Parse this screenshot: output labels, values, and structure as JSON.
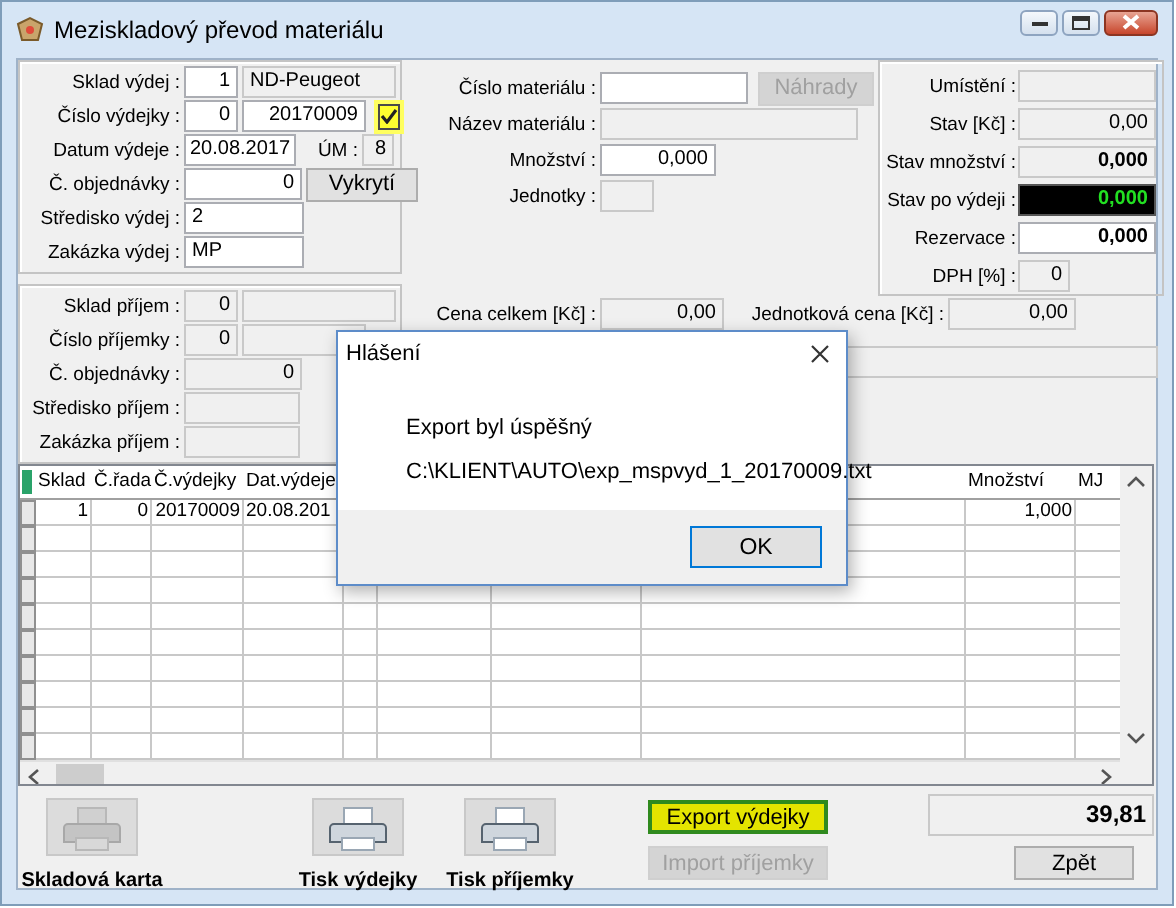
{
  "window": {
    "title": "Meziskladový převod materiálu"
  },
  "issue": {
    "warehouse": {
      "label": "Sklad výdej :",
      "code": {
        "value": "1",
        "readonly": false
      },
      "name": {
        "value": "ND-Peugeot",
        "readonly": true
      }
    },
    "slip": {
      "label": "Číslo výdejky :",
      "series": {
        "value": "0",
        "readonly": false
      },
      "number": {
        "value": "20170009",
        "readonly": false
      },
      "confirm": {
        "checked": true,
        "highlighted": true
      }
    },
    "date": {
      "label": "Datum výdeje :",
      "field": {
        "value": "20.08.2017",
        "readonly": false
      },
      "um_label": "ÚM :",
      "um": {
        "value": "8",
        "readonly": true
      }
    },
    "order": {
      "label": "Č. objednávky :",
      "field": {
        "value": "0",
        "readonly": false
      },
      "button": {
        "label": "Vykrytí",
        "disabled": false
      }
    },
    "center": {
      "label": "Středisko výdej :",
      "field": {
        "value": "2",
        "readonly": false
      }
    },
    "job": {
      "label": "Zakázka výdej :",
      "field": {
        "value": "MP",
        "readonly": false
      }
    }
  },
  "receipt": {
    "warehouse": {
      "label": "Sklad příjem :",
      "code": {
        "value": "0",
        "readonly": true
      },
      "name": {
        "readonly": true
      }
    },
    "slip": {
      "label": "Číslo příjemky :",
      "series": {
        "value": "0",
        "readonly": true
      },
      "number": {
        "readonly": true
      }
    },
    "order": {
      "label": "Č. objednávky :",
      "field": {
        "value": "0",
        "readonly": true
      }
    },
    "center": {
      "label": "Středisko příjem :",
      "field": {
        "readonly": true
      }
    },
    "job": {
      "label": "Zakázka příjem :",
      "field": {
        "readonly": true
      }
    }
  },
  "material": {
    "number": {
      "label": "Číslo materiálu :",
      "field": {
        "readonly": false
      },
      "button": {
        "label": "Náhrady",
        "disabled": true
      }
    },
    "name": {
      "label": "Název materiálu :",
      "field": {
        "readonly": true
      }
    },
    "quantity": {
      "label": "Množství :",
      "field": {
        "value": "0,000",
        "readonly": false
      }
    },
    "unit": {
      "label": "Jednotky :",
      "field": {
        "readonly": true
      }
    }
  },
  "stock": {
    "location": {
      "label": "Umístění :",
      "field": {
        "readonly": true
      }
    },
    "value": {
      "label": "Stav [Kč] :",
      "field": {
        "value": "0,00",
        "readonly": true
      }
    },
    "quantity": {
      "label": "Stav množství :",
      "field": {
        "value": "0,000",
        "readonly": true
      }
    },
    "after_issue": {
      "label": "Stav po výdeji :",
      "field": {
        "value": "0,000"
      }
    },
    "reservation": {
      "label": "Rezervace :",
      "field": {
        "value": "0,000",
        "readonly": false
      }
    },
    "vat": {
      "label": "DPH [%] :",
      "field": {
        "value": "0",
        "readonly": true
      }
    }
  },
  "prices": {
    "total": {
      "label": "Cena celkem [Kč] :",
      "field": {
        "value": "0,00",
        "readonly": true
      }
    },
    "unit": {
      "label": "Jednotková cena [Kč] :",
      "field": {
        "value": "0,00",
        "readonly": true
      }
    },
    "note": {
      "readonly": true
    }
  },
  "table": {
    "columns": [
      "Sklad",
      "Č.řada",
      "Č.výdejky",
      "Dat.výdeje",
      "Množství",
      "MJ"
    ],
    "rows": [
      {
        "cells": [
          "1",
          "0",
          "20170009",
          "20.08.201",
          "1,000"
        ]
      }
    ]
  },
  "footer": {
    "card": {
      "label": "Skladová karta",
      "disabled": true
    },
    "print_issue": {
      "label": "Tisk výdejky",
      "disabled": false
    },
    "print_receipt": {
      "label": "Tisk příjemky",
      "disabled": false
    },
    "export": {
      "label": "Export výdejky",
      "disabled": false,
      "highlighted": true
    },
    "import": {
      "label": "Import příjemky",
      "disabled": true,
      "highlighted": false
    },
    "total": {
      "value": "39,81",
      "readonly": true
    },
    "back": {
      "label": "Zpět",
      "disabled": false
    }
  },
  "dialog": {
    "title": "Hlášení",
    "message": "Export byl úspěšný",
    "detail": "C:\\KLIENT\\AUTO\\exp_mspvyd_1_20170009.txt",
    "button": "OK"
  }
}
